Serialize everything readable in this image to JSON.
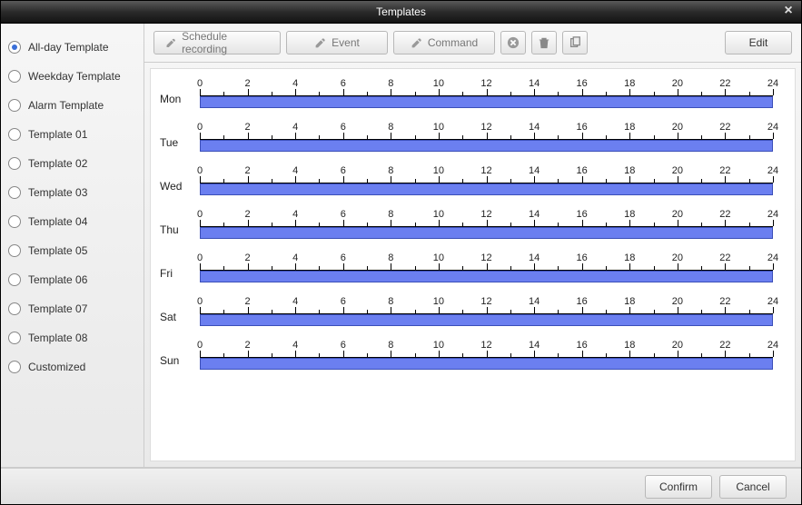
{
  "window": {
    "title": "Templates"
  },
  "sidebar": {
    "items": [
      {
        "label": "All-day Template",
        "selected": true
      },
      {
        "label": "Weekday Template",
        "selected": false
      },
      {
        "label": "Alarm Template",
        "selected": false
      },
      {
        "label": "Template 01",
        "selected": false
      },
      {
        "label": "Template 02",
        "selected": false
      },
      {
        "label": "Template 03",
        "selected": false
      },
      {
        "label": "Template 04",
        "selected": false
      },
      {
        "label": "Template 05",
        "selected": false
      },
      {
        "label": "Template 06",
        "selected": false
      },
      {
        "label": "Template 07",
        "selected": false
      },
      {
        "label": "Template 08",
        "selected": false
      },
      {
        "label": "Customized",
        "selected": false
      }
    ]
  },
  "toolbar": {
    "schedule_recording": "Schedule recording",
    "event": "Event",
    "command": "Command",
    "delete_icon": "delete-icon",
    "trash_icon": "trash-icon",
    "copy_icon": "copy-icon",
    "edit": "Edit"
  },
  "schedule": {
    "hours": [
      0,
      2,
      4,
      6,
      8,
      10,
      12,
      14,
      16,
      18,
      20,
      22,
      24
    ],
    "days": [
      {
        "label": "Mon",
        "bars": [
          {
            "from": 0,
            "to": 24
          }
        ]
      },
      {
        "label": "Tue",
        "bars": [
          {
            "from": 0,
            "to": 24
          }
        ]
      },
      {
        "label": "Wed",
        "bars": [
          {
            "from": 0,
            "to": 24
          }
        ]
      },
      {
        "label": "Thu",
        "bars": [
          {
            "from": 0,
            "to": 24
          }
        ]
      },
      {
        "label": "Fri",
        "bars": [
          {
            "from": 0,
            "to": 24
          }
        ]
      },
      {
        "label": "Sat",
        "bars": [
          {
            "from": 0,
            "to": 24
          }
        ]
      },
      {
        "label": "Sun",
        "bars": [
          {
            "from": 0,
            "to": 24
          }
        ]
      }
    ]
  },
  "footer": {
    "confirm": "Confirm",
    "cancel": "Cancel"
  },
  "colors": {
    "schedule_bar": "#6b7ff0"
  }
}
